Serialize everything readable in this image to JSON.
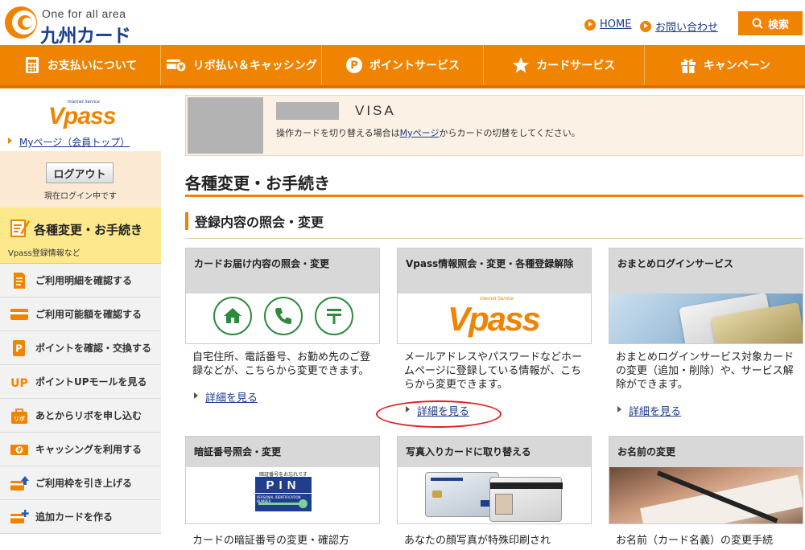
{
  "header": {
    "logo_en": "One for all area",
    "logo_jp": "九州カード",
    "home_link": "HOME",
    "contact_link": "お問い合わせ",
    "search_label": "検索"
  },
  "nav": [
    {
      "label": "お支払いについて",
      "icon": "calculator-icon"
    },
    {
      "label": "リボ払い＆キャッシング",
      "icon": "card-yen-icon"
    },
    {
      "label": "ポイントサービス",
      "icon": "point-p-icon"
    },
    {
      "label": "カードサービス",
      "icon": "star-icon"
    },
    {
      "label": "キャンペーン",
      "icon": "gift-icon"
    }
  ],
  "sidebar": {
    "vpass_logo": "Vpass",
    "vpass_sub": "Internet Service",
    "mypage_link": "Myページ（会員トップ）",
    "logout_label": "ログアウト",
    "logged_in_text": "現在ログイン中です",
    "current": {
      "title": "各種変更・お手続き",
      "sub": "Vpass登録情報など"
    },
    "items": [
      {
        "label": "ご利用明細を確認する",
        "icon": "statement-icon"
      },
      {
        "label": "ご利用可能額を確認する",
        "icon": "card-icon"
      },
      {
        "label": "ポイントを確認・交換する",
        "icon": "point-icon"
      },
      {
        "label": "ポイントUPモールを見る",
        "icon": "up-icon"
      },
      {
        "label": "あとからリボを申し込む",
        "icon": "revo-bag-icon"
      },
      {
        "label": "キャッシングを利用する",
        "icon": "cashing-yen-icon"
      },
      {
        "label": "ご利用枠を引き上げる",
        "icon": "limit-up-icon"
      },
      {
        "label": "追加カードを作る",
        "icon": "add-card-icon"
      }
    ]
  },
  "card_select": {
    "brand": "VISA",
    "note_before": "操作カードを切り替える場合は",
    "note_link": "Myページ",
    "note_after": "からカードの切替をしてください。"
  },
  "page_title": "各種変更・お手続き",
  "section_title": "登録内容の照会・変更",
  "more_label": "詳細を見る",
  "tiles": [
    {
      "title": "カードお届け内容の照会・変更",
      "desc": "自宅住所、電話番号、お勤め先のご登録などが、こちらから変更できます。"
    },
    {
      "title": "Vpass情報照会・変更・各種登録解除",
      "desc": "メールアドレスやパスワードなどホームページに登録している情報が、こちらから変更できます。"
    },
    {
      "title": "おまとめログインサービス",
      "desc": "おまとめログインサービス対象カードの変更（追加・削除）や、サービス解除ができます。"
    },
    {
      "title": "暗証番号照会・変更",
      "desc": "カードの暗証番号の変更・確認方"
    },
    {
      "title": "写真入りカードに取り替える",
      "desc": "あなたの顔写真が特殊印刷され"
    },
    {
      "title": "お名前の変更",
      "desc": "お名前（カード名義）の変更手続"
    }
  ],
  "pin_graphic": {
    "caption": "暗証番号をお忘れですか？",
    "text": "PIN",
    "sub": "PERSONAL IDENTIFICATION NUMBER"
  },
  "colors": {
    "accent": "#f08300",
    "brand_blue": "#1a3a8c",
    "link": "#1a3a8c",
    "icon_green": "#2e8b3e",
    "highlight_red": "#e02020"
  }
}
